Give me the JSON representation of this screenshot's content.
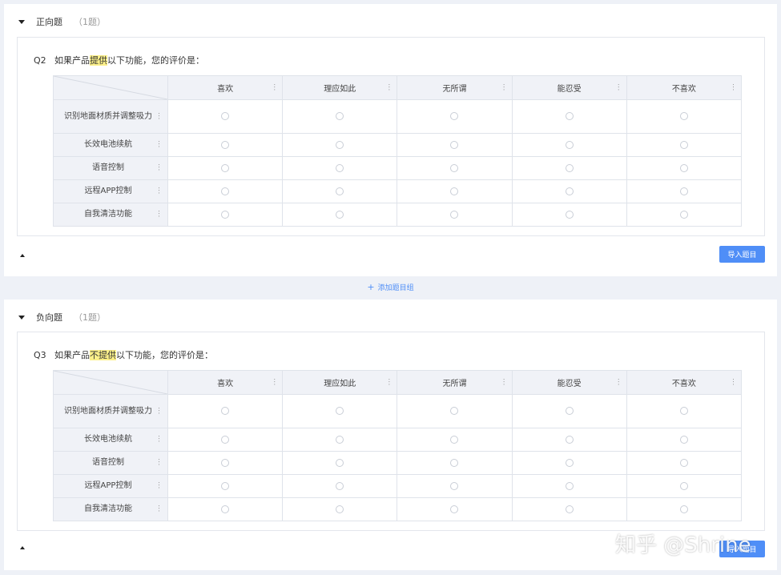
{
  "groups": [
    {
      "title": "正向题",
      "count": "（1题）",
      "question": {
        "number": "Q2",
        "text_before": "如果产品",
        "text_highlight": "提供",
        "text_after": "以下功能，您的评价是："
      },
      "import_label": "导入题目"
    },
    {
      "title": "负向题",
      "count": "（1题）",
      "question": {
        "number": "Q3",
        "text_before": "如果产品",
        "text_highlight": "不提供",
        "text_after": "以下功能，您的评价是："
      },
      "import_label": "导入题目"
    }
  ],
  "columns": [
    "喜欢",
    "理应如此",
    "无所谓",
    "能忍受",
    "不喜欢"
  ],
  "rows": [
    "识别地面材质并调整吸力",
    "长效电池续航",
    "语音控制",
    "远程APP控制",
    "自我清洁功能"
  ],
  "add_group_label": "添加题目组",
  "add_group_icon": "plus-icon",
  "more_icon": "vertical-dots-icon",
  "watermark": "知乎 @Shrine",
  "colors": {
    "accent": "#4f8ef7",
    "highlight": "#fcf08a",
    "header_bg": "#f0f2f7"
  }
}
